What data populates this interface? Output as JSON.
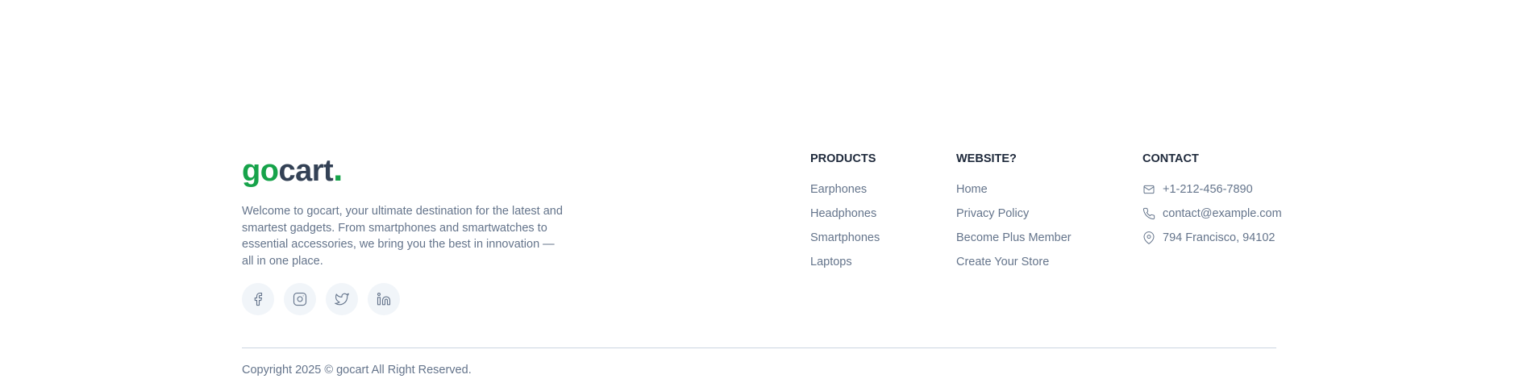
{
  "brand": {
    "logo_go": "go",
    "logo_cart": "cart",
    "logo_dot": ".",
    "description": "Welcome to gocart, your ultimate destination for the latest and smartest gadgets. From smartphones and smartwatches to essential accessories, we bring you the best in innovation — all in one place."
  },
  "socials": [
    {
      "icon": "facebook-icon"
    },
    {
      "icon": "instagram-icon"
    },
    {
      "icon": "twitter-icon"
    },
    {
      "icon": "linkedin-icon"
    }
  ],
  "products": {
    "title": "PRODUCTS",
    "items": [
      "Earphones",
      "Headphones",
      "Smartphones",
      "Laptops"
    ]
  },
  "website": {
    "title": "WEBSITE?",
    "items": [
      "Home",
      "Privacy Policy",
      "Become Plus Member",
      "Create Your Store"
    ]
  },
  "contact": {
    "title": "CONTACT",
    "phone": "+1-212-456-7890",
    "email": "contact@example.com",
    "address": "794 Francisco, 94102",
    "icons": [
      "mail-icon",
      "phone-icon",
      "map-pin-icon"
    ]
  },
  "copyright": "Copyright 2025 © gocart All Right Reserved.",
  "colors": {
    "accent": "#16a34a",
    "heading": "#1e293b",
    "text": "#64748b",
    "social_bg": "#f1f5f9",
    "divider": "#cbd5e1"
  }
}
